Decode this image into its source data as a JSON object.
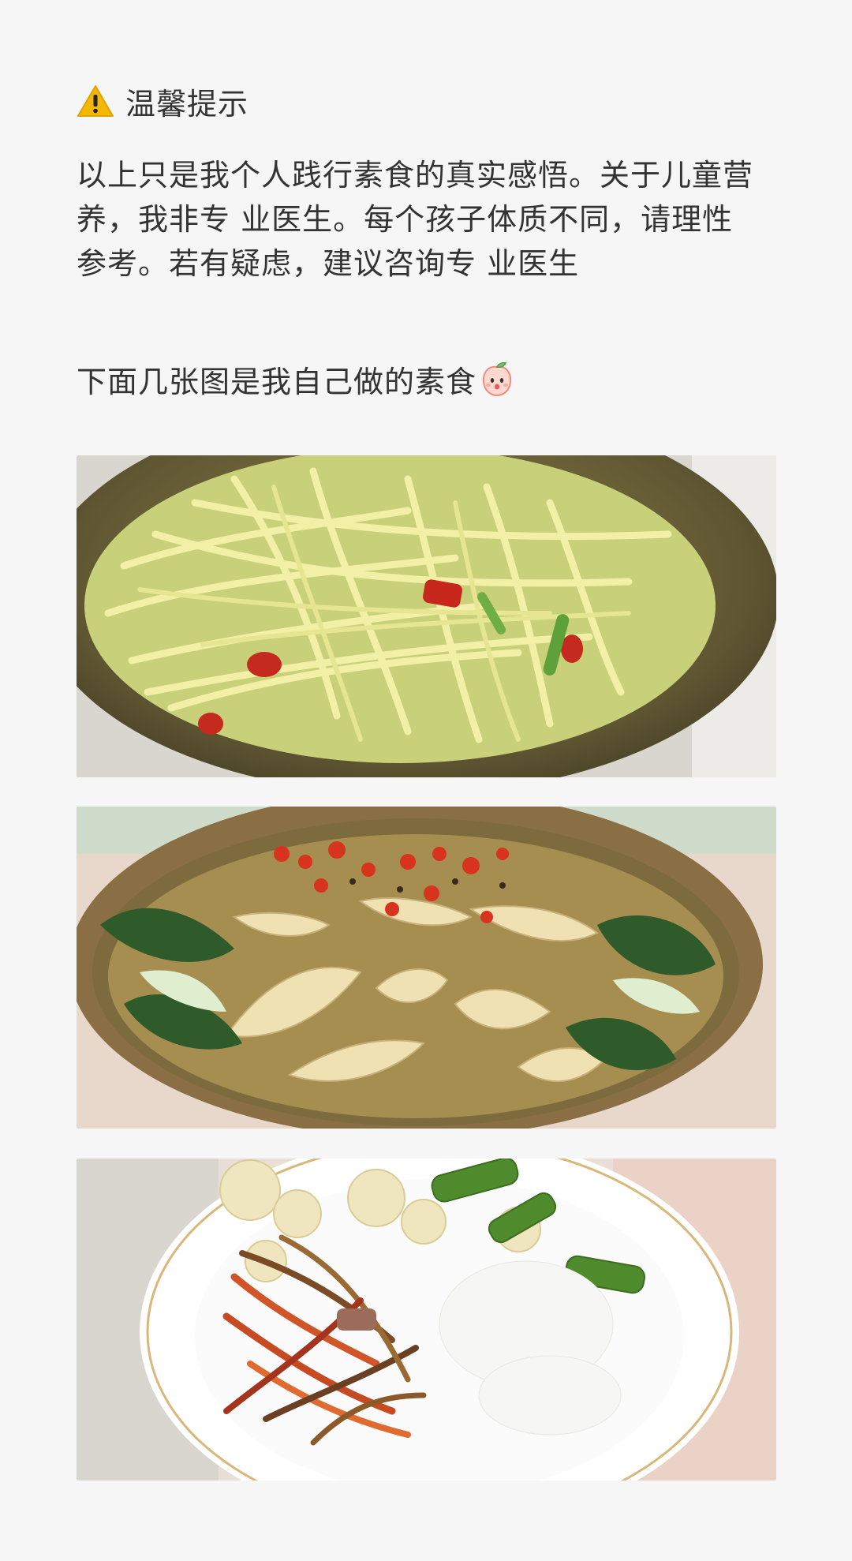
{
  "tip": {
    "icon": "warning-icon",
    "title": "温馨提示"
  },
  "paragraph": {
    "line1": "以上只是我个人践行素食的真实感悟。关于儿童营",
    "line2": "养，我非专 业医生。每个孩子体质不同，请理性",
    "line3": "参考。若有疑虑，建议咨询专 业医生"
  },
  "intro": {
    "text": "下面几张图是我自己做的素食",
    "emoji": "peach-face-icon"
  },
  "photos": [
    {
      "subject": "stir-fried shredded potato with chili"
    },
    {
      "subject": "vegetable soup with bamboo shoots and bok choy"
    },
    {
      "subject": "plate with rice, cauliflower, peppers and stir-fried shreds"
    }
  ],
  "colors": {
    "background": "#f6f6f6",
    "text": "#333333",
    "warning": "#f5b800"
  }
}
